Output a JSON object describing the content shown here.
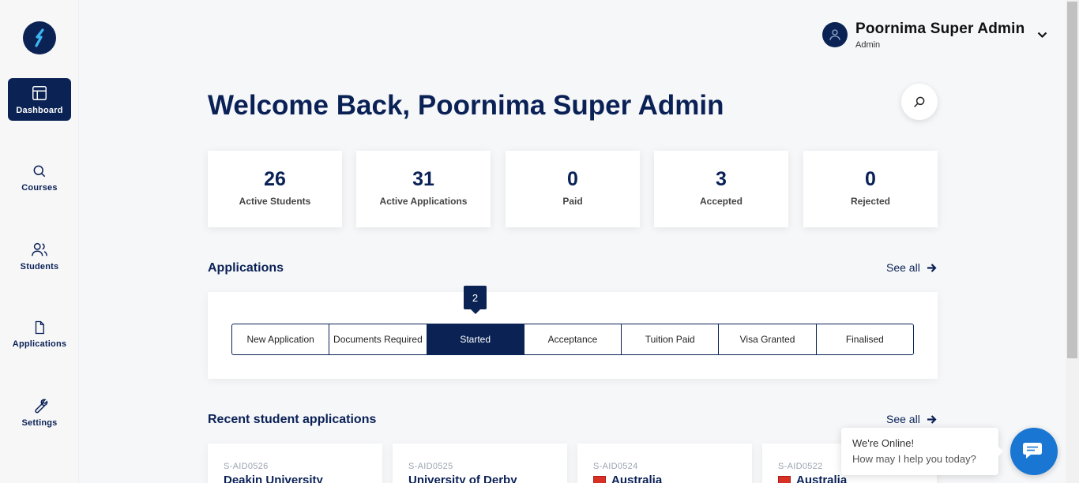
{
  "sidebar": {
    "logo": "brand-logo",
    "items": [
      {
        "label": "Dashboard",
        "icon": "layout-icon",
        "active": true
      },
      {
        "label": "Courses",
        "icon": "search-icon"
      },
      {
        "label": "Students",
        "icon": "users-icon"
      },
      {
        "label": "Applications",
        "icon": "file-icon"
      },
      {
        "label": "Settings",
        "icon": "wrench-icon"
      }
    ]
  },
  "header": {
    "user_name": "Poornima Super Admin",
    "user_role": "Admin"
  },
  "welcome": "Welcome Back, Poornima Super Admin",
  "stats": [
    {
      "value": "26",
      "label": "Active Students"
    },
    {
      "value": "31",
      "label": "Active Applications"
    },
    {
      "value": "0",
      "label": "Paid"
    },
    {
      "value": "3",
      "label": "Accepted"
    },
    {
      "value": "0",
      "label": "Rejected"
    }
  ],
  "applications": {
    "title": "Applications",
    "see_all": "See all",
    "active_count": "2",
    "stages": [
      "New Application",
      "Documents Required",
      "Started",
      "Acceptance",
      "Tuition Paid",
      "Visa Granted",
      "Finalised"
    ],
    "active_stage": "Started"
  },
  "recent": {
    "title": "Recent student applications",
    "see_all": "See all",
    "cards": [
      {
        "id": "S-AID0526",
        "title": "Deakin University"
      },
      {
        "id": "S-AID0525",
        "title": "University of Derby"
      },
      {
        "id": "S-AID0524",
        "title": "Australia",
        "flag": "#d93025"
      },
      {
        "id": "S-AID0522",
        "title": "Australia",
        "flag": "#d93025"
      }
    ]
  },
  "chat": {
    "line1": "We're Online!",
    "line2": "How may I help you today?"
  },
  "colors": {
    "navy": "#0b2354",
    "chat_blue": "#1976d2"
  }
}
